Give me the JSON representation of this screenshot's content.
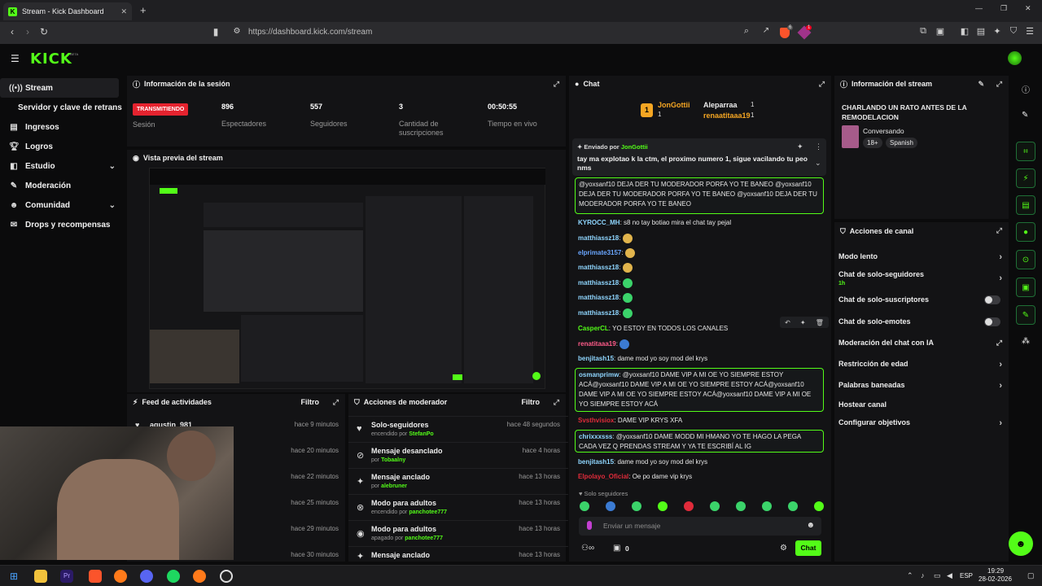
{
  "browser": {
    "tab_title": "Stream - Kick Dashboard",
    "url": "https://dashboard.kick.com/stream",
    "new_tab": "+",
    "ext_badge_1": "6",
    "ext_badge_2": "1"
  },
  "brand": {
    "logo": "KICK",
    "beta": "BETA",
    "accent": "#53fc18"
  },
  "nav": {
    "items": [
      {
        "label": "Stream",
        "icon": "broadcast-icon"
      },
      {
        "label": "Servidor y clave de retransmisión"
      },
      {
        "label": "Ingresos",
        "icon": "money-icon"
      },
      {
        "label": "Logros",
        "icon": "trophy-icon"
      },
      {
        "label": "Estudio",
        "icon": "studio-icon"
      },
      {
        "label": "Moderación",
        "icon": "wrench-icon"
      },
      {
        "label": "Comunidad",
        "icon": "community-icon"
      },
      {
        "label": "Drops y recompensas",
        "icon": "gift-icon"
      }
    ]
  },
  "session": {
    "title": "Información de la sesión",
    "live_badge": "TRANSMITIENDO",
    "live_label": "Sesión",
    "stats": [
      {
        "value": "896",
        "label": "Espectadores"
      },
      {
        "value": "557",
        "label": "Seguidores"
      },
      {
        "value": "3",
        "label": "Cantidad de suscripciones"
      },
      {
        "value": "00:50:55",
        "label": "Tiempo en vivo"
      }
    ]
  },
  "preview": {
    "title": "Vista previa del stream"
  },
  "feed": {
    "title": "Feed de actividades",
    "filter": "Filtro",
    "rows": [
      {
        "user": "agustin_981",
        "time": "hace 9 minutos"
      },
      {
        "user": "",
        "time": "hace 20 minutos"
      },
      {
        "user": "",
        "time": "hace 22 minutos"
      },
      {
        "user": "",
        "time": "hace 25 minutos"
      },
      {
        "user": "",
        "time": "hace 29 minutos"
      },
      {
        "user": "",
        "time": "hace 30 minutos"
      }
    ]
  },
  "modactions": {
    "title": "Acciones de moderador",
    "filter": "Filtro",
    "rows": [
      {
        "title": "Solo-seguidores",
        "sub": "encendido por",
        "user": "StefanPo",
        "time": "hace 48 segundos",
        "icon": "heart-icon"
      },
      {
        "title": "Mensaje desanclado",
        "sub": "por",
        "user": "Tobaalny",
        "time": "hace 4 horas",
        "icon": "unpin-icon"
      },
      {
        "title": "Mensaje anclado",
        "sub": "por",
        "user": "alebruner",
        "time": "hace 13 horas",
        "icon": "pin-icon"
      },
      {
        "title": "Modo para adultos",
        "sub": "encendido por",
        "user": "panchotee777",
        "time": "hace 13 horas",
        "icon": "eye-off-icon"
      },
      {
        "title": "Modo para adultos",
        "sub": "apagado por",
        "user": "panchotee777",
        "time": "hace 13 horas",
        "icon": "eye-icon"
      },
      {
        "title": "Mensaje anclado",
        "sub": "",
        "user": "",
        "time": "hace 13 horas",
        "icon": "pin-icon"
      }
    ]
  },
  "chat": {
    "title": "Chat",
    "top": [
      {
        "rank": "1",
        "user": "JonGottii",
        "count": "1"
      },
      {
        "rank": "",
        "user": "Aleparraa",
        "count": "1"
      },
      {
        "rank": "",
        "user": "renaatitaaa19",
        "count": "1"
      }
    ],
    "pinned": {
      "sent_by": "Enviado por",
      "user": "JonGottii",
      "text": "tay ma explotao k la ctm, el proximo numero 1, sigue vacilando tu peo nms"
    },
    "hl1": "@yoxsanf10 DEJA DER TU MODERADOR PORFA YO TE BANEO @yoxsanf10 DEJA DER TU MODERADOR PORFA YO TE BANEO @yoxsanf10 DEJA DER TU MODERADOR PORFA YO TE BANEO",
    "messages": [
      {
        "user": "KYROCC_MH",
        "color": "#8fd6ff",
        "text": "s8 no tay botiao mira el chat tay pejal"
      },
      {
        "user": "matthiassz18",
        "color": "#8fd6ff",
        "text": ""
      },
      {
        "user": "elprimate3157",
        "color": "#6aa6ff",
        "text": ""
      },
      {
        "user": "matthiassz18",
        "color": "#8fd6ff",
        "text": ""
      },
      {
        "user": "matthiassz18",
        "color": "#8fd6ff",
        "text": ""
      },
      {
        "user": "matthiassz18",
        "color": "#8fd6ff",
        "text": ""
      },
      {
        "user": "matthiassz18",
        "color": "#8fd6ff",
        "text": ""
      },
      {
        "user": "CasperCL",
        "color": "#53fc18",
        "text": "YO ESTOY EN TODOS LOS CANALES"
      },
      {
        "user": "renatitaaa19",
        "color": "#ff5c8a",
        "text": ""
      },
      {
        "user": "benjitash15",
        "color": "#8fd6ff",
        "text": "dame mod yo soy mod del krys"
      }
    ],
    "hl2": {
      "user": "osmanprimw",
      "text": "@yoxsanf10 DAME VIP A MI OE YO SIEMPRE ESTOY ACÁ@yoxsanf10 DAME VIP A MI OE YO SIEMPRE ESTOY ACÁ@yoxsanf10 DAME VIP A MI OE YO SIEMPRE ESTOY ACÁ@yoxsanf10 DAME VIP A MI OE YO SIEMPRE ESTOY ACÁ"
    },
    "msg_vip": {
      "user": "Svsthvisiox",
      "text": "DAME VIP KRYS XFA"
    },
    "hl3": {
      "user": "chrixxxsss",
      "text": "@yoxsanf10 DAME MODD MI HMANO YO TE HAGO LA PEGA CADA VEZ Q PRENDAS STREAM Y YA TE ESCRIBÍ AL IG"
    },
    "msg_b": {
      "user": "benjitash15",
      "text": "dame mod yo soy mod del krys"
    },
    "msg_e": {
      "user": "Elpolayo_Oficial",
      "text": "Oe po dame vip krys"
    },
    "followers_only": "Solo seguidores",
    "placeholder": "Enviar un mensaje",
    "points": "0",
    "send": "Chat"
  },
  "streaminfo": {
    "title": "Información del stream",
    "stream_title": "CHARLANDO UN RATO ANTES DE LA REMODELACION",
    "category": "Conversando",
    "tags": [
      "18+",
      "Spanish"
    ]
  },
  "channel": {
    "title": "Acciones de canal",
    "items": [
      {
        "label": "Modo lento",
        "kind": "arrow"
      },
      {
        "label": "Chat de solo-seguidores",
        "sub": "1h",
        "kind": "arrow"
      },
      {
        "label": "Chat de solo-suscriptores",
        "kind": "toggle"
      },
      {
        "label": "Chat de solo-emotes",
        "kind": "toggle"
      },
      {
        "label": "Moderación del chat con IA",
        "kind": "ext"
      },
      {
        "label": "Restricción de edad",
        "kind": "arrow"
      },
      {
        "label": "Palabras baneadas",
        "kind": "arrow"
      },
      {
        "label": "Hostear canal",
        "kind": ""
      },
      {
        "label": "Configurar objetivos",
        "kind": "arrow"
      }
    ]
  },
  "taskbar": {
    "lang": "ESP",
    "time": "19:29",
    "date": "28-02-2026"
  }
}
